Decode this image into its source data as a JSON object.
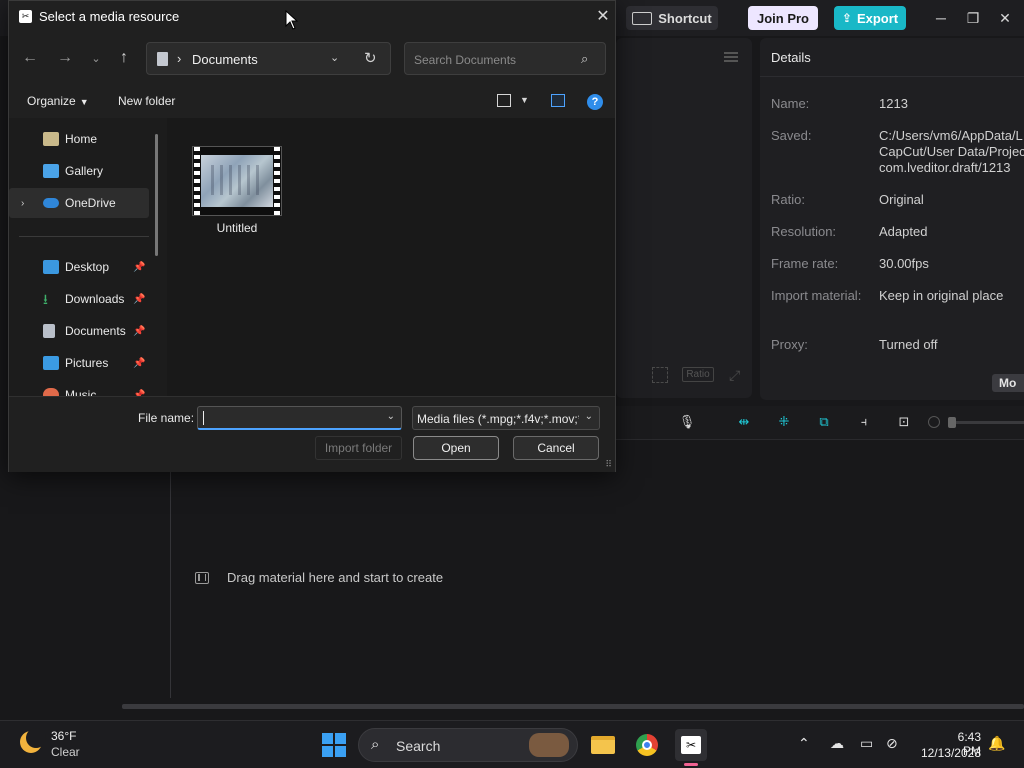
{
  "app": {
    "shortcut_label": "Shortcut",
    "join_pro_label": "Join Pro",
    "export_label": "Export",
    "ratio_label": "Ratio",
    "details": {
      "title": "Details",
      "rows": [
        {
          "label": "Name:",
          "value": "1213"
        },
        {
          "label": "Saved:",
          "value": "C:/Users/vm6/AppData/L\nCapCut/User Data/Projec\ncom.lveditor.draft/1213"
        },
        {
          "label": "Ratio:",
          "value": "Original"
        },
        {
          "label": "Resolution:",
          "value": "Adapted"
        },
        {
          "label": "Frame rate:",
          "value": "30.00fps"
        },
        {
          "label": "Import material:",
          "value": "Keep in original place"
        },
        {
          "label": "Proxy:",
          "value": "Turned off"
        }
      ],
      "modify_label": "Mo"
    },
    "timeline": {
      "drag_hint": "Drag material here and start to create"
    }
  },
  "dialog": {
    "title": "Select a media resource",
    "address": "Documents",
    "search_placeholder": "Search Documents",
    "organize_label": "Organize",
    "new_folder_label": "New folder",
    "nav_items": [
      {
        "label": "Home",
        "icon": "home-icon",
        "pinned": false
      },
      {
        "label": "Gallery",
        "icon": "gallery-icon",
        "pinned": false
      },
      {
        "label": "OneDrive",
        "icon": "cloud-icon",
        "pinned": false,
        "selected": true
      },
      {
        "label": "Desktop",
        "icon": "desktop-icon",
        "pinned": true
      },
      {
        "label": "Downloads",
        "icon": "download-icon",
        "pinned": true
      },
      {
        "label": "Documents",
        "icon": "document-icon",
        "pinned": true
      },
      {
        "label": "Pictures",
        "icon": "picture-icon",
        "pinned": true
      },
      {
        "label": "Music",
        "icon": "music-icon",
        "pinned": true
      }
    ],
    "files": [
      {
        "name": "Untitled",
        "icon": "video-file-icon"
      }
    ],
    "file_name_label": "File name:",
    "file_name_value": "",
    "filter_value": "Media files (*.mpg;*.f4v;*.mov;*",
    "import_folder_label": "Import folder",
    "open_label": "Open",
    "cancel_label": "Cancel"
  },
  "taskbar": {
    "temperature": "36°F",
    "condition": "Clear",
    "search_label": "Search",
    "time": "6:43 PM",
    "date": "12/13/2023"
  },
  "colors": {
    "accent_blue": "#4da3ff",
    "export_teal": "#19b8c7",
    "join_pro_bg": "#ede6ff"
  }
}
